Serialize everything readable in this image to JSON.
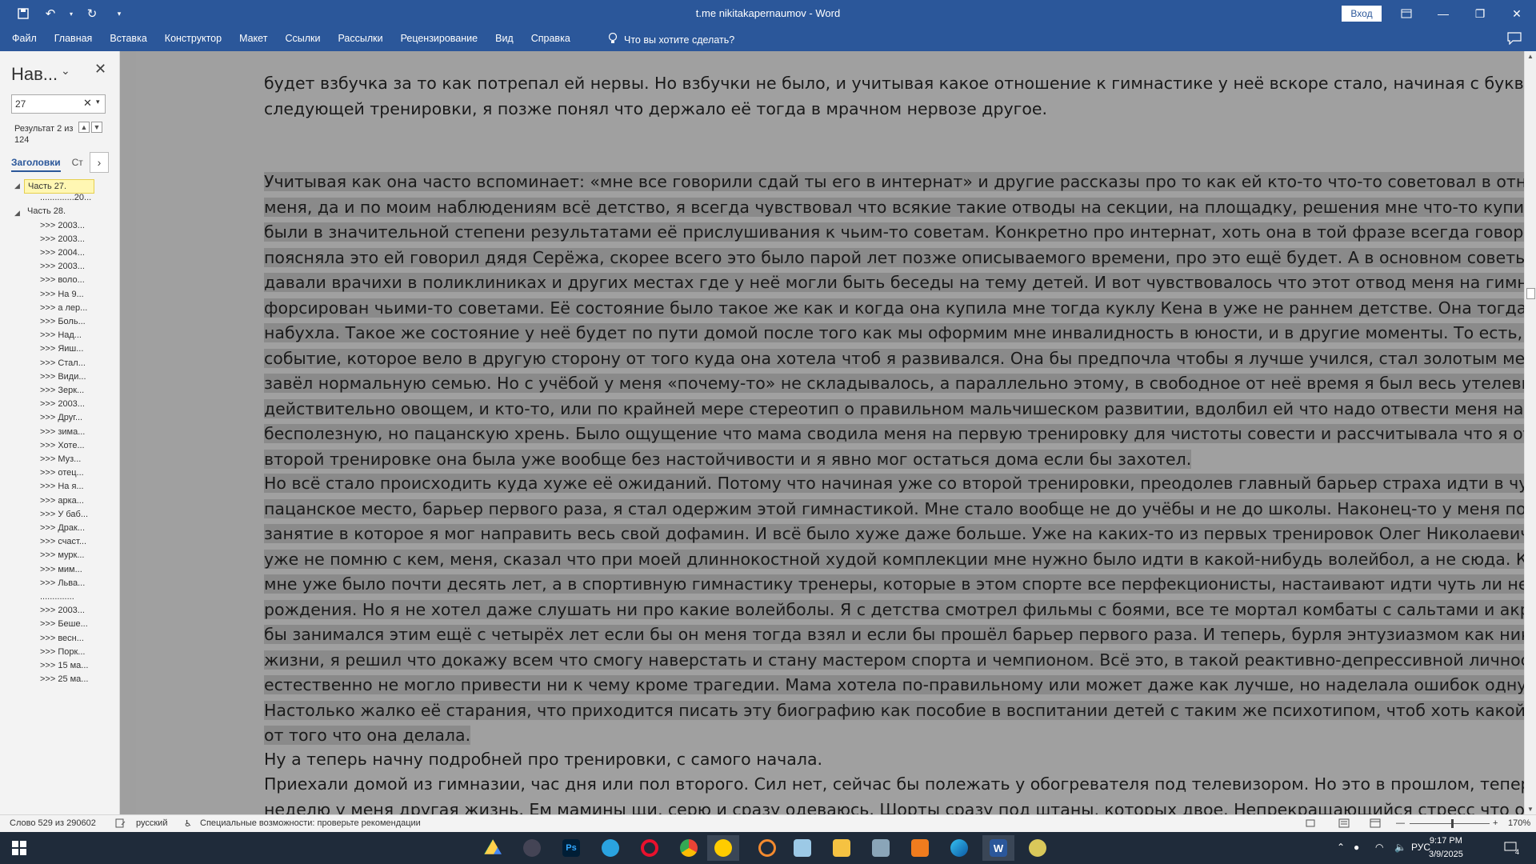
{
  "titlebar": {
    "title": "t.me nikitakapernaumov - Word",
    "signin": "Вход",
    "minimize": "—",
    "restore": "❐",
    "close": "✕"
  },
  "menu": {
    "tabs": [
      "Файл",
      "Главная",
      "Вставка",
      "Конструктор",
      "Макет",
      "Ссылки",
      "Рассылки",
      "Рецензирование",
      "Вид",
      "Справка"
    ],
    "tell_me": "Что вы хотите сделать?"
  },
  "nav": {
    "title": "Нав...",
    "search_value": "27",
    "result_text": "Результат 2 из 124",
    "tab_headings": "Заголовки",
    "tab_pages": "Ст",
    "items": [
      {
        "label": "Часть 27.",
        "level": "sel"
      },
      {
        "label": "..............20...",
        "level": "l2"
      },
      {
        "label": "Часть 28.",
        "level": "l1"
      },
      {
        "label": ">>> 2003...",
        "level": "l2"
      },
      {
        "label": ">>> 2003...",
        "level": "l2"
      },
      {
        "label": ">>> 2004...",
        "level": "l2"
      },
      {
        "label": ">>> 2003...",
        "level": "l2"
      },
      {
        "label": ">>> воло...",
        "level": "l2"
      },
      {
        "label": ">>> На 9...",
        "level": "l2"
      },
      {
        "label": ">>> а лер...",
        "level": "l2"
      },
      {
        "label": ">>> Боль...",
        "level": "l2"
      },
      {
        "label": ">>> Над...",
        "level": "l2"
      },
      {
        "label": ">>> Яиш...",
        "level": "l2"
      },
      {
        "label": ">>> Стал...",
        "level": "l2"
      },
      {
        "label": ">>> Види...",
        "level": "l2"
      },
      {
        "label": ">>> Зерк...",
        "level": "l2"
      },
      {
        "label": ">>> 2003...",
        "level": "l2"
      },
      {
        "label": ">>> Друг...",
        "level": "l2"
      },
      {
        "label": ">>> зима...",
        "level": "l2"
      },
      {
        "label": ">>> Хоте...",
        "level": "l2"
      },
      {
        "label": ">>> Муз...",
        "level": "l2"
      },
      {
        "label": ">>> отец...",
        "level": "l2"
      },
      {
        "label": ">>> На я...",
        "level": "l2"
      },
      {
        "label": ">>>  арка...",
        "level": "l2"
      },
      {
        "label": ">>> У баб...",
        "level": "l2"
      },
      {
        "label": ">>> Драк...",
        "level": "l2"
      },
      {
        "label": ">>> счаст...",
        "level": "l2"
      },
      {
        "label": ">>> мурк...",
        "level": "l2"
      },
      {
        "label": ">>> мим...",
        "level": "l2"
      },
      {
        "label": ">>> Льва...",
        "level": "l2"
      },
      {
        "label": "..............",
        "level": "l2"
      },
      {
        "label": ">>> 2003...",
        "level": "l2"
      },
      {
        "label": ">>> Беше...",
        "level": "l2"
      },
      {
        "label": ">>>  весн...",
        "level": "l2"
      },
      {
        "label": ">>> Порк...",
        "level": "l2"
      },
      {
        "label": ">>> 15 ма...",
        "level": "l2"
      },
      {
        "label": ">>> 25 ма...",
        "level": "l2"
      }
    ]
  },
  "document": {
    "p1": "будет взбучка за то как потрепал ей нервы. Но взбучки не было, и учитывая какое отношение к гимнастике у неё вскоре стало, начиная с буквально следующей тренировки, я позже понял что держало её тогда в мрачном нервозе другое.",
    "p2": "Учитывая как она часто вспоминает: «мне все говорили сдай ты его в интернат» и другие рассказы про то как ей кто-то что-то советовал в отношении меня, да и по моим наблюдениям всё детство, я всегда чувствовал что всякие такие отводы на секции, на площадку, решения мне что-то купить и прочее - были в значительной степени результатами её прислушивания к чьим-то советам. Конкретно про интернат, хоть она в той фразе всегда говорит «все», она поясняла это ей говорил дядя Серёжа, скорее всего это было парой лет позже описываемого времени, про это ещё будет. А в основном советы по мне ей давали врачихи в поликлиниках и других местах где у неё могли быть беседы на тему детей. И вот чувствовалось что этот отвод меня на гимнастику был форсирован чьими-то советами. Её состояние было такое же как и когда она купила мне тогда куклу Кена в уже не раннем детстве. Она тогда тоже набухла. Такое же состояние у неё будет по пути домой после того как мы оформим мне инвалидность в юности, и в другие моменты. То есть, некое событие, которое вело в другую сторону от того куда она хотела чтоб я развивался. Она бы предпочла чтобы я лучше учился, стал золотым медалистом, завёл нормальную семью. Но с учёбой у меня «почему-то» не складывалось, а параллельно этому, в свободное от неё время я был весь утелевизорным, действительно овощем, и кто-то, или по крайней мере стереотип о правильном мальчишеском развитии, вдолбил ей что надо отвести меня на эту бесполезную, но пацанскую хрень. Было ощущение что мама сводила меня на первую тренировку для чистоты совести и рассчитывала что я откажусь. Ко второй тренировке она была уже вообще без настойчивости и я явно мог остаться дома если бы захотел.",
    "p3": "Но всё стало происходить куда хуже её ожиданий. Потому что начиная уже со второй тренировки, преодолев главный барьер страха идти в чужое пацанское место, барьер первого раза, я стал одержим этой гимнастикой. Мне стало вообще не до учёбы и не до школы. Наконец-то у меня появилось занятие в которое я мог направить весь свой дофамин. И всё было хуже даже больше. Уже на каких-то из первых тренировок Олег Николаевич, обсуждая, уже не помню с кем, меня, сказал что при моей длиннокостной худой комплекции мне нужно было идти в какой-нибудь волейбол, а не сюда. Кроме того, мне уже было почти десять лет, а в спортивную гимнастику тренеры, которые в этом спорте все перфекционисты, настаивают идти чуть ли не до рождения. Но я не хотел даже слушать ни про какие волейболы. Я с детства смотрел фильмы с боями, все те мортал комбаты с сальтами и акробатикой. Я бы занимался этим ещё с четырёх лет если бы он меня тогда взял и если бы прошёл барьер первого раза. И теперь, бурля энтузиазмом как никогда в жизни, я решил что докажу всем что смогу наверстать и стану мастером спорта и чемпионом. Всё это, в такой реактивно-депрессивной личности как я, естественно не могло привести ни к чему кроме трагедии. Мама хотела по-правильному или может даже как лучше, но наделала ошибок одну на другой. Настолько жалко её старания, что приходится писать эту биографию как пособие в воспитании детей с таким же психотипом, чтоб хоть какой-то был прок от того что она делала.",
    "p4": "Ну а теперь начну подробней про тренировки, с самого начала.",
    "p5": "Приехали домой из гимназии, час дня или пол второго. Сил нет, сейчас бы полежать у обогревателя под телевизором. Но это в прошлом, теперь три раза в неделю у меня другая жизнь. Ем мамины щи, серю и сразу одеваюсь. Шорты сразу под штаны, которых двое. Непрекращающийся стресс что опоздаю, вечное волнение и гнет в солнечном сплетении. Это вскоре станет одним из самых «моих» ощущений. Если бы нужно было узнать свою жизнь по ощущению,"
  },
  "status": {
    "words": "Слово 529 из 290602",
    "language": "русский",
    "accessibility": "Специальные возможности: проверьте рекомендации",
    "zoom": "170%"
  },
  "taskbar": {
    "lang": "РУС",
    "time": "9:17 PM",
    "date": "3/9/2025",
    "notif_count": "4"
  },
  "colors": {
    "accent": "#2b579a",
    "selection": "#8a8a8a"
  }
}
